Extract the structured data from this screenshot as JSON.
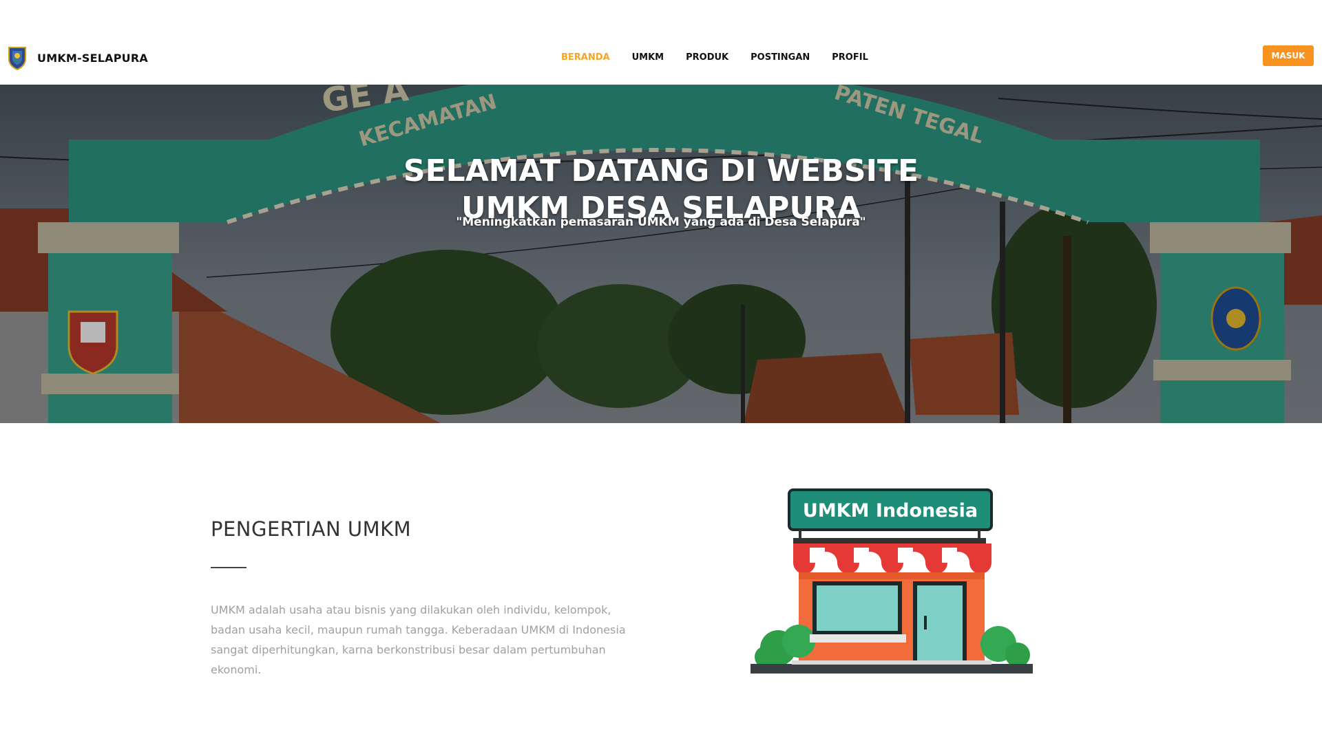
{
  "navbar": {
    "brand_name": "UMKM-SELAPURA",
    "menu": [
      {
        "label": "BERANDA",
        "active": true
      },
      {
        "label": "UMKM",
        "active": false
      },
      {
        "label": "PRODUK",
        "active": false
      },
      {
        "label": "POSTINGAN",
        "active": false
      },
      {
        "label": "PROFIL",
        "active": false
      }
    ],
    "login_label": "MASUK"
  },
  "hero": {
    "title_line1": "SELAMAT DATANG DI WEBSITE",
    "title_line2": "UMKM DESA SELAPURA",
    "subtitle": "\"Meningkatkan pemasaran UMKM yang ada di Desa Selapura\"",
    "arch_text_top": "GE                   A",
    "arch_text_left": "KECAMATAN",
    "arch_text_right": "PATEN TEGAL"
  },
  "about": {
    "heading": "PENGERTIAN UMKM",
    "text": "UMKM adalah usaha atau bisnis yang dilakukan oleh individu, kelompok, badan usaha kecil, maupun rumah tangga. Keberadaan UMKM di Indonesia sangat diperhitungkan, karna berkonstribusi besar dalam pertumbuhan ekonomi."
  },
  "store_illustration": {
    "sign_text": "UMKM Indonesia"
  },
  "colors": {
    "accent": "#f7931e",
    "active_nav": "#f5a623",
    "arch_green": "#2f9a86",
    "sign_green": "#1e8e78"
  }
}
